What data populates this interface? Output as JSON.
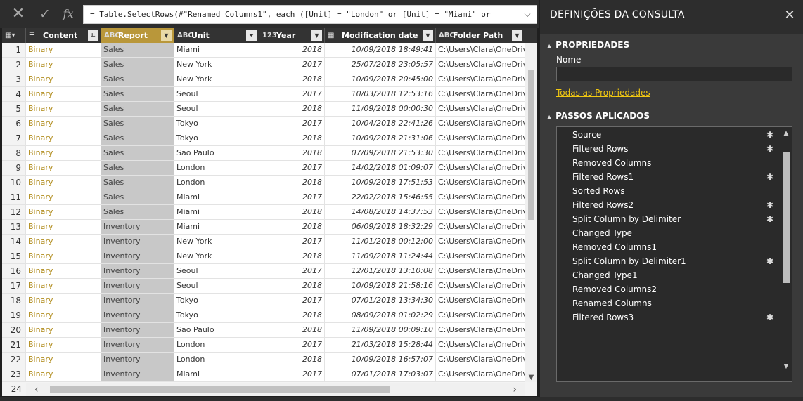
{
  "formula_bar": {
    "cancel_glyph": "✕",
    "commit_glyph": "✓",
    "fx_label": "fx",
    "formula": "= Table.SelectRows(#\"Renamed Columns1\", each ([Unit] = \"London\" or [Unit] = \"Miami\" or",
    "expand_glyph": "⌵"
  },
  "grid": {
    "columns": [
      {
        "type_icon": "▦▾",
        "name": ""
      },
      {
        "type_icon": "☰",
        "name": "Content"
      },
      {
        "type_icon": "ABC",
        "name": "Report"
      },
      {
        "type_icon": "ABC",
        "name": "Unit"
      },
      {
        "type_icon": "123",
        "name": "Year"
      },
      {
        "type_icon": "▦",
        "name": "Modification date"
      },
      {
        "type_icon": "ABC",
        "name": "Folder Path"
      }
    ],
    "rows": [
      [
        "1",
        "Binary",
        "Sales",
        "Miami",
        "2018",
        "10/09/2018 18:49:41",
        "C:\\Users\\Clara\\OneDrive\\"
      ],
      [
        "2",
        "Binary",
        "Sales",
        "New York",
        "2017",
        "25/07/2018 23:05:57",
        "C:\\Users\\Clara\\OneDrive\\"
      ],
      [
        "3",
        "Binary",
        "Sales",
        "New York",
        "2018",
        "10/09/2018 20:45:00",
        "C:\\Users\\Clara\\OneDrive\\"
      ],
      [
        "4",
        "Binary",
        "Sales",
        "Seoul",
        "2017",
        "10/03/2018 12:53:16",
        "C:\\Users\\Clara\\OneDrive\\"
      ],
      [
        "5",
        "Binary",
        "Sales",
        "Seoul",
        "2018",
        "11/09/2018 00:00:30",
        "C:\\Users\\Clara\\OneDrive\\"
      ],
      [
        "6",
        "Binary",
        "Sales",
        "Tokyo",
        "2017",
        "10/04/2018 22:41:26",
        "C:\\Users\\Clara\\OneDrive\\"
      ],
      [
        "7",
        "Binary",
        "Sales",
        "Tokyo",
        "2018",
        "10/09/2018 21:31:06",
        "C:\\Users\\Clara\\OneDrive\\"
      ],
      [
        "8",
        "Binary",
        "Sales",
        "Sao Paulo",
        "2018",
        "07/09/2018 21:53:30",
        "C:\\Users\\Clara\\OneDrive\\"
      ],
      [
        "9",
        "Binary",
        "Sales",
        "London",
        "2017",
        "14/02/2018 01:09:07",
        "C:\\Users\\Clara\\OneDrive\\"
      ],
      [
        "10",
        "Binary",
        "Sales",
        "London",
        "2018",
        "10/09/2018 17:51:53",
        "C:\\Users\\Clara\\OneDrive\\"
      ],
      [
        "11",
        "Binary",
        "Sales",
        "Miami",
        "2017",
        "22/02/2018 15:46:55",
        "C:\\Users\\Clara\\OneDrive\\"
      ],
      [
        "12",
        "Binary",
        "Sales",
        "Miami",
        "2018",
        "14/08/2018 14:37:53",
        "C:\\Users\\Clara\\OneDrive\\"
      ],
      [
        "13",
        "Binary",
        "Inventory",
        "Miami",
        "2018",
        "06/09/2018 18:32:29",
        "C:\\Users\\Clara\\OneDrive\\"
      ],
      [
        "14",
        "Binary",
        "Inventory",
        "New York",
        "2017",
        "11/01/2018 00:12:00",
        "C:\\Users\\Clara\\OneDrive\\"
      ],
      [
        "15",
        "Binary",
        "Inventory",
        "New York",
        "2018",
        "11/09/2018 11:24:44",
        "C:\\Users\\Clara\\OneDrive\\"
      ],
      [
        "16",
        "Binary",
        "Inventory",
        "Seoul",
        "2017",
        "12/01/2018 13:10:08",
        "C:\\Users\\Clara\\OneDrive\\"
      ],
      [
        "17",
        "Binary",
        "Inventory",
        "Seoul",
        "2018",
        "10/09/2018 21:58:16",
        "C:\\Users\\Clara\\OneDrive\\"
      ],
      [
        "18",
        "Binary",
        "Inventory",
        "Tokyo",
        "2017",
        "07/01/2018 13:34:30",
        "C:\\Users\\Clara\\OneDrive\\"
      ],
      [
        "19",
        "Binary",
        "Inventory",
        "Tokyo",
        "2018",
        "08/09/2018 01:02:29",
        "C:\\Users\\Clara\\OneDrive\\"
      ],
      [
        "20",
        "Binary",
        "Inventory",
        "Sao Paulo",
        "2018",
        "11/09/2018 00:09:10",
        "C:\\Users\\Clara\\OneDrive\\"
      ],
      [
        "21",
        "Binary",
        "Inventory",
        "London",
        "2017",
        "21/03/2018 15:28:44",
        "C:\\Users\\Clara\\OneDrive\\"
      ],
      [
        "22",
        "Binary",
        "Inventory",
        "London",
        "2018",
        "10/09/2018 16:57:07",
        "C:\\Users\\Clara\\OneDrive\\"
      ],
      [
        "23",
        "Binary",
        "Inventory",
        "Miami",
        "2017",
        "07/01/2018 17:03:07",
        "C:\\Users\\Clara\\OneDrive\\"
      ]
    ],
    "last_row_number": "24"
  },
  "pane": {
    "title": "DEFINIÇÕES DA CONSULTA",
    "close_glyph": "✕",
    "properties_title": "PROPRIEDADES",
    "name_label": "Nome",
    "name_value": "",
    "all_properties_link": "Todas as Propriedades",
    "steps_title": "PASSOS APLICADOS",
    "steps": [
      {
        "label": "Source",
        "gear": true
      },
      {
        "label": "Filtered Rows",
        "gear": true
      },
      {
        "label": "Removed Columns",
        "gear": false
      },
      {
        "label": "Filtered Rows1",
        "gear": true
      },
      {
        "label": "Sorted Rows",
        "gear": false
      },
      {
        "label": "Filtered Rows2",
        "gear": true
      },
      {
        "label": "Split Column by Delimiter",
        "gear": true
      },
      {
        "label": "Changed Type",
        "gear": false
      },
      {
        "label": "Removed Columns1",
        "gear": false
      },
      {
        "label": "Split Column by Delimiter1",
        "gear": true
      },
      {
        "label": "Changed Type1",
        "gear": false
      },
      {
        "label": "Removed Columns2",
        "gear": false
      },
      {
        "label": "Renamed Columns",
        "gear": false
      },
      {
        "label": "Filtered Rows3",
        "gear": true
      }
    ],
    "gear_glyph": "✱"
  },
  "colors": {
    "selected_header": "#b9973a",
    "binary_text": "#b08b1a",
    "link": "#f2c811"
  }
}
